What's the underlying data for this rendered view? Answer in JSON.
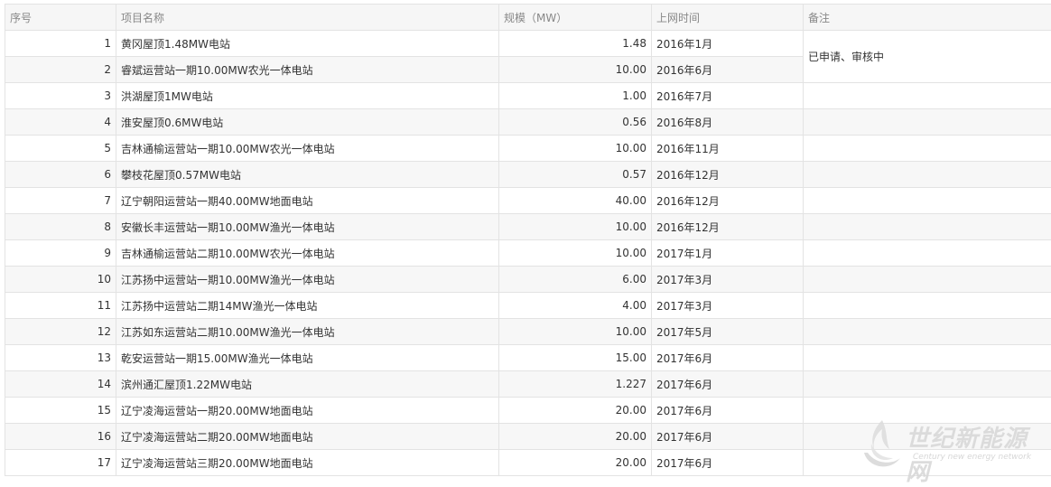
{
  "table": {
    "headers": {
      "index": "序号",
      "name": "项目名称",
      "scale": "规模（MW）",
      "date": "上网时间",
      "remark": "备注"
    },
    "rows": [
      {
        "index": "1",
        "name": "黄冈屋顶1.48MW电站",
        "scale": "1.48",
        "date": "2016年1月"
      },
      {
        "index": "2",
        "name": "睿斌运营站一期10.00MW农光一体电站",
        "scale": "10.00",
        "date": "2016年6月"
      },
      {
        "index": "3",
        "name": "洪湖屋顶1MW电站",
        "scale": "1.00",
        "date": "2016年7月"
      },
      {
        "index": "4",
        "name": "淮安屋顶0.6MW电站",
        "scale": "0.56",
        "date": "2016年8月"
      },
      {
        "index": "5",
        "name": "吉林通榆运营站一期10.00MW农光一体电站",
        "scale": "10.00",
        "date": "2016年11月"
      },
      {
        "index": "6",
        "name": "攀枝花屋顶0.57MW电站",
        "scale": "0.57",
        "date": "2016年12月"
      },
      {
        "index": "7",
        "name": "辽宁朝阳运营站一期40.00MW地面电站",
        "scale": "40.00",
        "date": "2016年12月"
      },
      {
        "index": "8",
        "name": "安徽长丰运营站一期10.00MW渔光一体电站",
        "scale": "10.00",
        "date": "2016年12月"
      },
      {
        "index": "9",
        "name": "吉林通榆运营站二期10.00MW农光一体电站",
        "scale": "10.00",
        "date": "2017年1月"
      },
      {
        "index": "10",
        "name": "江苏扬中运营站一期10.00MW渔光一体电站",
        "scale": "6.00",
        "date": "2017年3月"
      },
      {
        "index": "11",
        "name": "江苏扬中运营站二期14MW渔光一体电站",
        "scale": "4.00",
        "date": "2017年3月"
      },
      {
        "index": "12",
        "name": "江苏如东运营站二期10.00MW渔光一体电站",
        "scale": "10.00",
        "date": "2017年5月"
      },
      {
        "index": "13",
        "name": "乾安运营站一期15.00MW渔光一体电站",
        "scale": "15.00",
        "date": "2017年6月"
      },
      {
        "index": "14",
        "name": "滨州通汇屋顶1.22MW电站",
        "scale": "1.227",
        "date": "2017年6月"
      },
      {
        "index": "15",
        "name": "辽宁凌海运营站一期20.00MW地面电站",
        "scale": "20.00",
        "date": "2017年6月"
      },
      {
        "index": "16",
        "name": "辽宁凌海运营站二期20.00MW地面电站",
        "scale": "20.00",
        "date": "2017年6月"
      },
      {
        "index": "17",
        "name": "辽宁凌海运营站三期20.00MW地面电站",
        "scale": "20.00",
        "date": "2017年6月"
      }
    ],
    "remark_text": "已申请、审核中"
  },
  "watermark": {
    "cn": "世纪新能源网",
    "en": "Century new energy network",
    "icon": "flame-swirl-logo"
  }
}
